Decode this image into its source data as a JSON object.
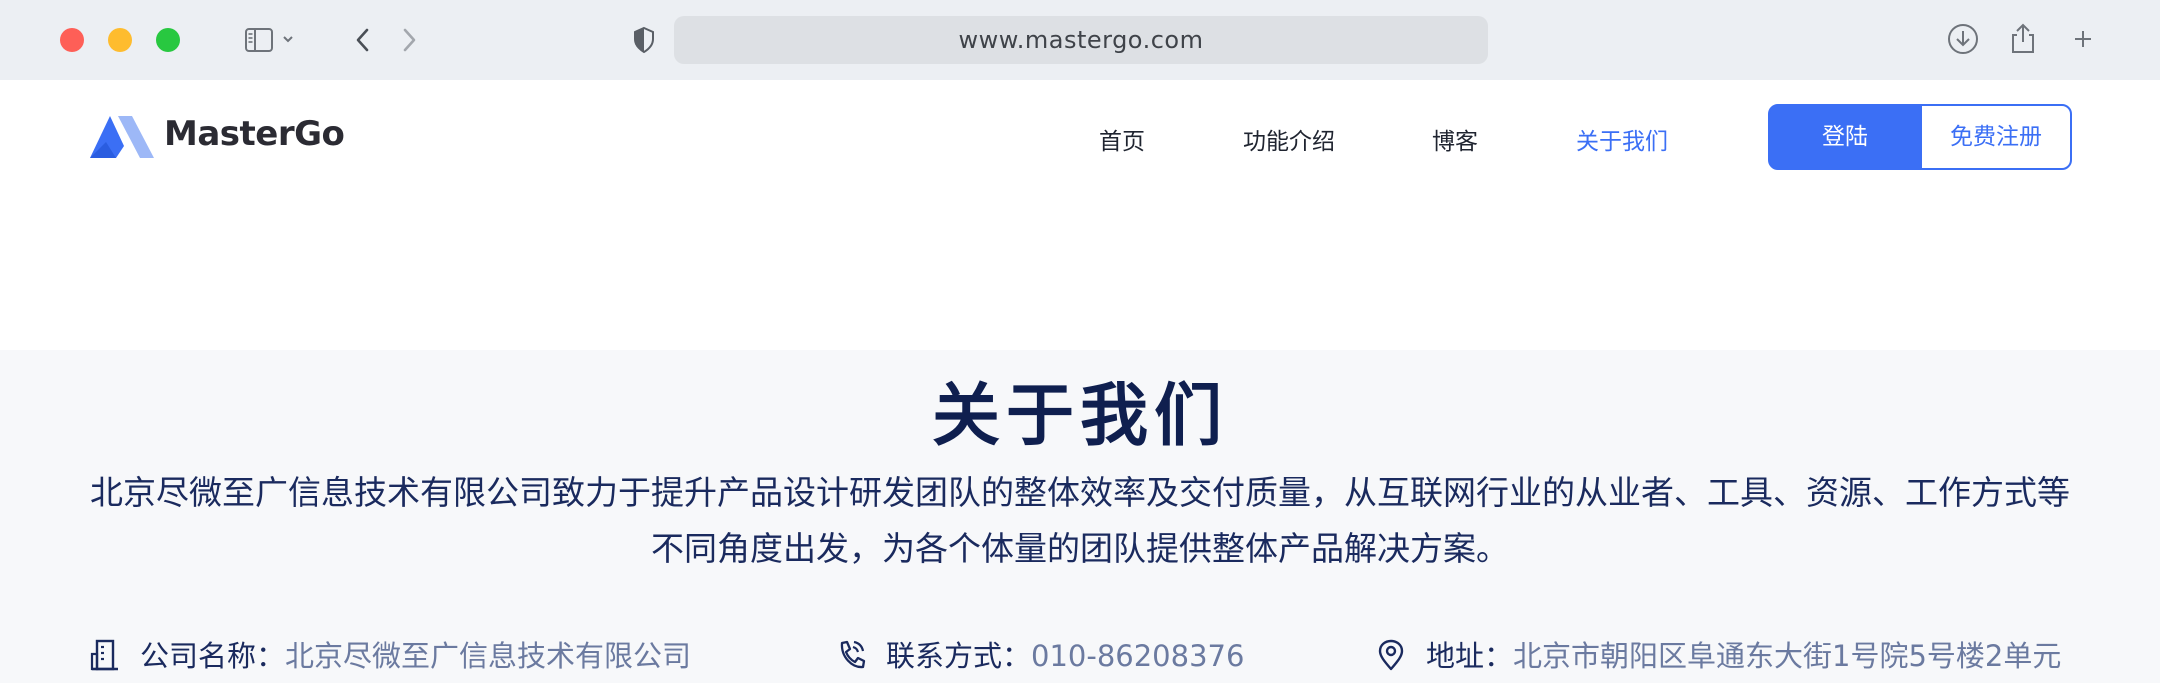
{
  "browser": {
    "url": "www.mastergo.com"
  },
  "site": {
    "brand": "MasterGo",
    "nav": [
      {
        "label": "首页"
      },
      {
        "label": "功能介绍"
      },
      {
        "label": "博客"
      },
      {
        "label": "关于我们",
        "active": true
      }
    ],
    "login_label": "登陆",
    "register_label": "免费注册",
    "accent_color": "#3b6ff5"
  },
  "about": {
    "title": "关于我们",
    "description": "北京尽微至广信息技术有限公司致力于提升产品设计研发团队的整体效率及交付质量，从互联网行业的从业者、工具、资源、工作方式等不同角度出发，为各个体量的团队提供整体产品解决方案。",
    "company_label": "公司名称：",
    "company_value": "北京尽微至广信息技术有限公司",
    "phone_label": "联系方式：",
    "phone_value": "010-86208376",
    "address_label": "地址：",
    "address_value": "北京市朝阳区阜通东大街1号院5号楼2单元"
  }
}
